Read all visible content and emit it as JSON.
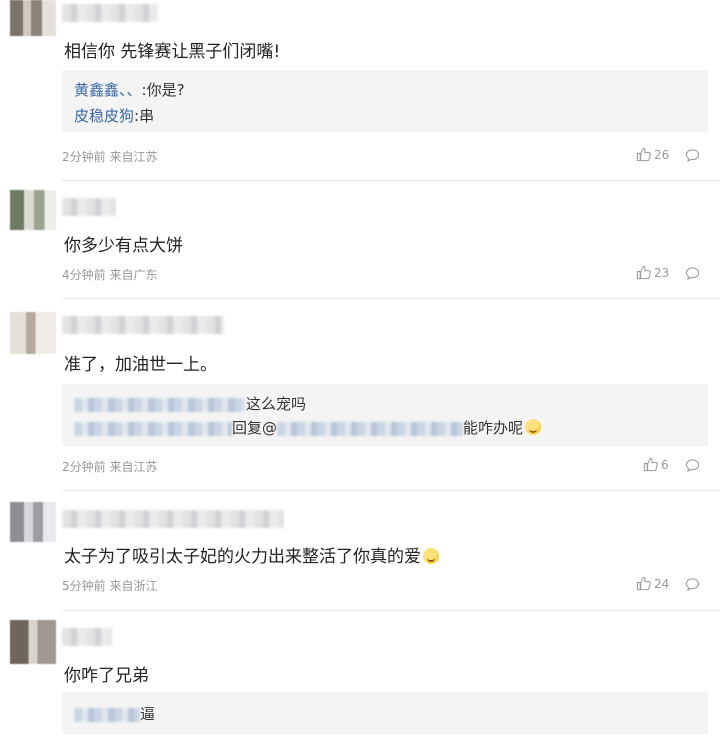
{
  "comments": [
    {
      "text": "相信你 先锋赛让黑子们闭嘴!",
      "replies": [
        {
          "user": "黄鑫鑫、、",
          "text": ":你是?"
        },
        {
          "user": "皮稳皮狗",
          "text": ":串"
        }
      ],
      "time": "2分钟前",
      "location": "来自江苏",
      "likes": "26"
    },
    {
      "text": "你多少有点大饼",
      "time": "4分钟前",
      "location": "来自广东",
      "likes": "23"
    },
    {
      "text": "准了，加油世一上。",
      "replies": [
        {
          "text": "这么宠吗"
        },
        {
          "prefix": "回复@",
          "text": "能咋办呢"
        }
      ],
      "time": "2分钟前",
      "location": "来自江苏",
      "likes": "6"
    },
    {
      "text": "太子为了吸引太子妃的火力出来整活了你真的爱",
      "time": "5分钟前",
      "location": "来自浙江",
      "likes": "24"
    },
    {
      "text": "你咋了兄弟",
      "replies": [
        {
          "text": "逼"
        }
      ]
    }
  ],
  "icons": {
    "like": "thumbs-up-icon",
    "reply": "comment-bubble-icon",
    "emoji": "kiss-face-emoji"
  }
}
